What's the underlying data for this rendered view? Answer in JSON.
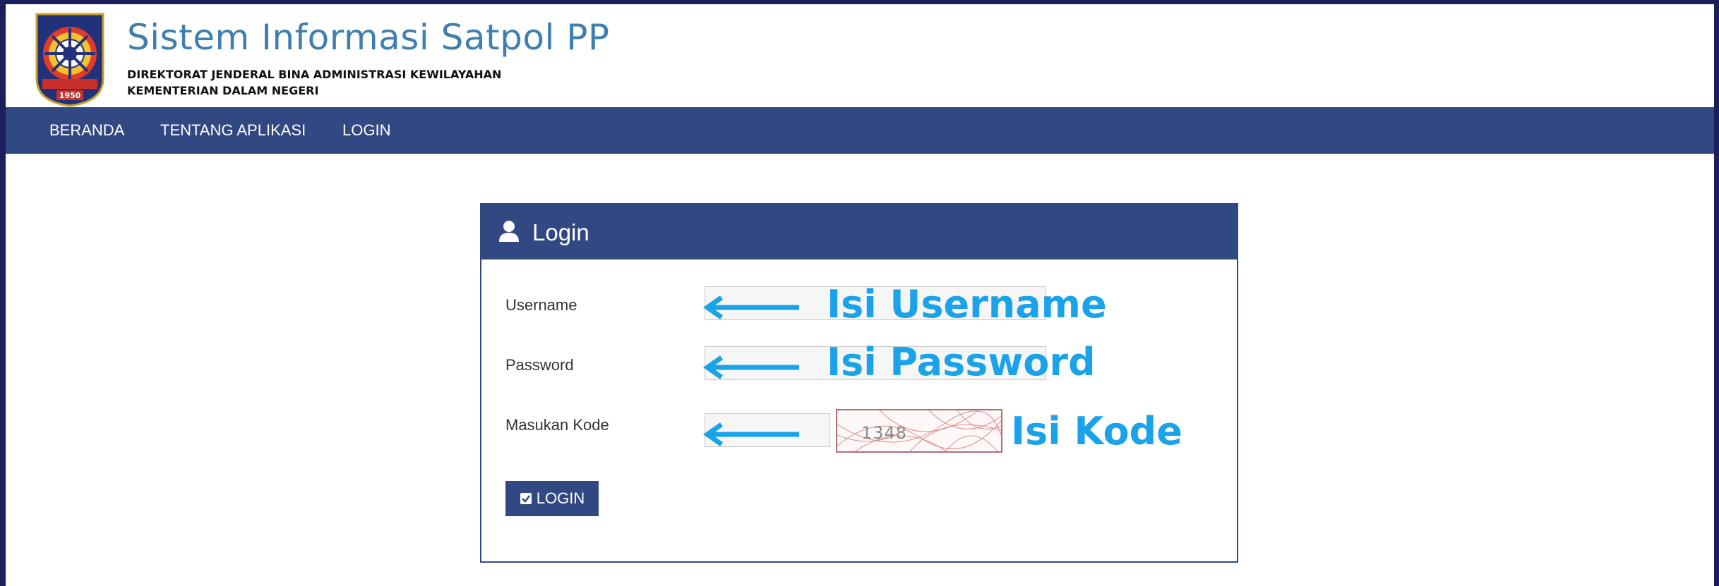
{
  "header": {
    "title": "Sistem Informasi Satpol PP",
    "org_line1": "DIREKTORAT JENDERAL BINA ADMINISTRASI KEWILAYAHAN",
    "org_line2": "KEMENTERIAN DALAM NEGERI",
    "logo_year": "1950"
  },
  "nav": {
    "items": [
      "BERANDA",
      "TENTANG APLIKASI",
      "LOGIN"
    ]
  },
  "login_panel": {
    "title": "Login",
    "username_label": "Username",
    "password_label": "Password",
    "kode_label": "Masukan Kode",
    "username_value": "",
    "password_value": "",
    "kode_value": "",
    "captcha_text": "1348",
    "button_label": "LOGIN"
  },
  "annotations": {
    "username": "Isi Username",
    "password": "Isi Password",
    "kode": "Isi Kode"
  },
  "colors": {
    "nav_bg": "#324883",
    "title_blue": "#3f7fb0",
    "annotation_cyan": "#1aa3e8",
    "outer_frame": "#1c1f5c"
  },
  "icons": {
    "logo": "satpol-pp-emblem",
    "panel": "user-icon",
    "button": "check-square-icon",
    "pointer": "arrow-left-icon"
  }
}
